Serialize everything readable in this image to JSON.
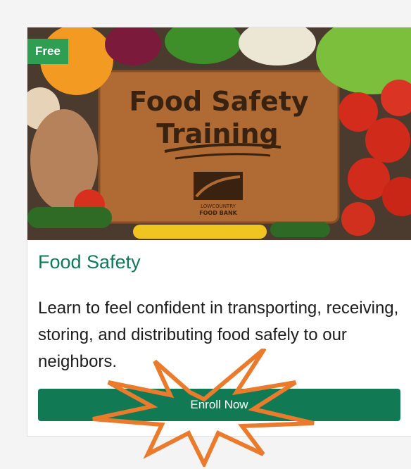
{
  "course": {
    "badge": "Free",
    "image_heading_line1": "Food Safety",
    "image_heading_line2": "Training",
    "logo_text_line1": "LOWCOUNTRY",
    "logo_text_line2": "FOOD BANK",
    "title": "Food Safety",
    "description": "Learn to feel confident in transporting, receiving, storing, and distributing food safely to our neighbors.",
    "cta_label": "Enroll Now"
  },
  "colors": {
    "accent_green": "#0f7a57",
    "button_green": "#117a54",
    "badge_green": "#2f9d52",
    "starburst_orange": "#ea7a2c"
  }
}
